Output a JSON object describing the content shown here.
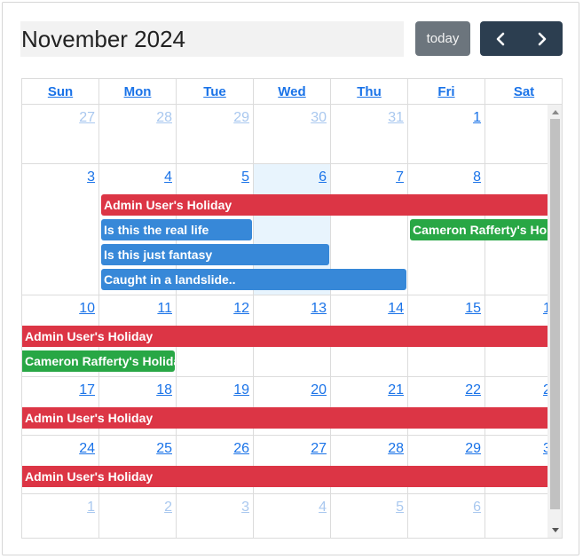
{
  "header": {
    "title": "November 2024",
    "today_label": "today",
    "prev_icon": "chevron-left-icon",
    "next_icon": "chevron-right-icon"
  },
  "days_of_week": [
    "Sun",
    "Mon",
    "Tue",
    "Wed",
    "Thu",
    "Fri",
    "Sat"
  ],
  "weeks": [
    {
      "days": [
        "27",
        "28",
        "29",
        "30",
        "31",
        "1",
        ""
      ],
      "other": [
        true,
        true,
        true,
        true,
        true,
        false,
        false
      ]
    },
    {
      "days": [
        "3",
        "4",
        "5",
        "6",
        "7",
        "8",
        ""
      ],
      "other": [
        false,
        false,
        false,
        false,
        false,
        false,
        false
      ]
    },
    {
      "days": [
        "10",
        "11",
        "12",
        "13",
        "14",
        "15",
        "1"
      ],
      "other": [
        false,
        false,
        false,
        false,
        false,
        false,
        false
      ]
    },
    {
      "days": [
        "17",
        "18",
        "19",
        "20",
        "21",
        "22",
        "2"
      ],
      "other": [
        false,
        false,
        false,
        false,
        false,
        false,
        false
      ]
    },
    {
      "days": [
        "24",
        "25",
        "26",
        "27",
        "28",
        "29",
        "3"
      ],
      "other": [
        false,
        false,
        false,
        false,
        false,
        false,
        false
      ]
    },
    {
      "days": [
        "1",
        "2",
        "3",
        "4",
        "5",
        "6",
        ""
      ],
      "other": [
        true,
        true,
        true,
        true,
        true,
        true,
        true
      ]
    }
  ],
  "events": {
    "admin_holiday": "Admin User's Holiday",
    "cameron_holiday": "Cameron Rafferty's Holiday",
    "real_life": "Is this the real life",
    "fantasy": "Is this just fantasy",
    "landslide": "Caught in a landslide.."
  },
  "colors": {
    "red": "#dc3545",
    "blue": "#3788d8",
    "green": "#28a745",
    "link": "#1a73e8",
    "nav_bg": "#2c3e50",
    "today_bg": "#6c757d",
    "today_cell": "#e8f4fd"
  }
}
